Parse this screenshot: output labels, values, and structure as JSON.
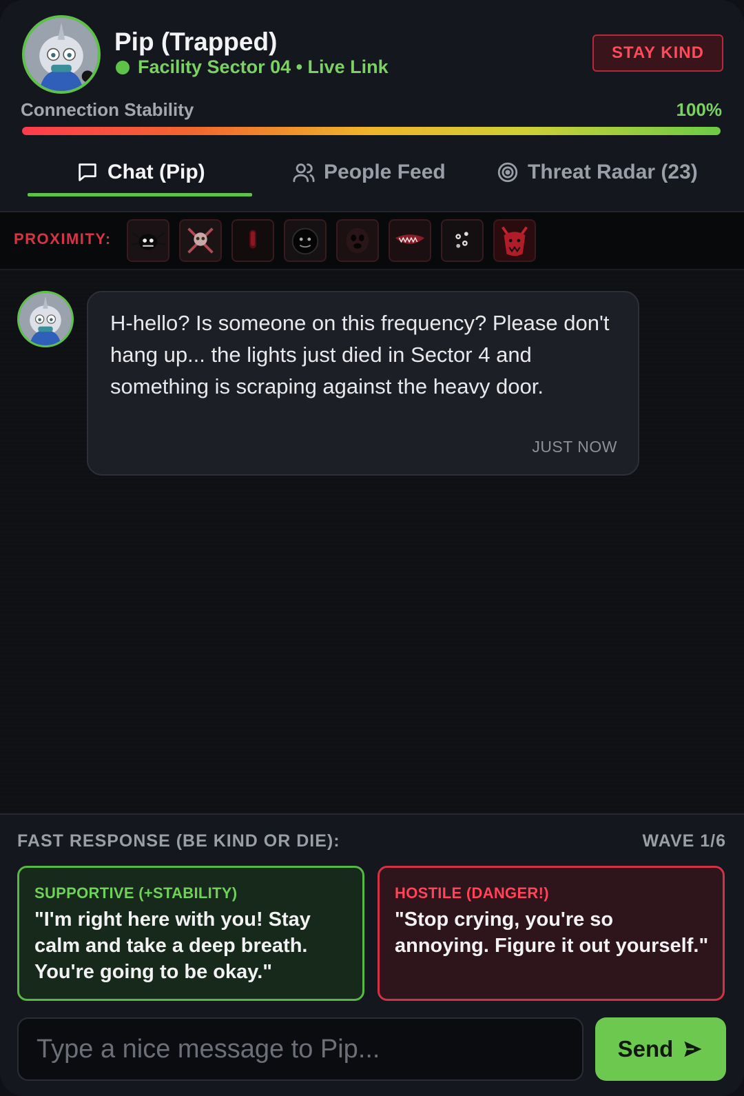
{
  "header": {
    "title": "Pip (Trapped)",
    "subtitle": "Facility Sector 04 • Live Link",
    "status_button": "STAY KIND",
    "stability_label": "Connection Stability",
    "stability_value": "100%",
    "stability_fraction": 1.0
  },
  "tabs": [
    {
      "label": "Chat (Pip)",
      "icon": "chat-bubble-icon",
      "active": true
    },
    {
      "label": "People Feed",
      "icon": "people-icon",
      "active": false
    },
    {
      "label": "Threat Radar (23)",
      "icon": "radar-icon",
      "active": false
    }
  ],
  "proximity": {
    "label": "PROXIMITY:",
    "threats": [
      "spider-creature-icon",
      "skull-crossbones-creature-icon",
      "red-shadow-figure-icon",
      "dark-orb-creature-icon",
      "hollow-face-creature-icon",
      "fanged-mouth-creature-icon",
      "scattered-eyes-creature-icon",
      "red-horned-demon-icon"
    ]
  },
  "chat": {
    "messages": [
      {
        "sender": "Pip",
        "text": "H-hello? Is someone on this frequency? Please don't hang up... the lights just died in Sector 4 and something is scraping against the heavy door.",
        "time": "JUST NOW"
      }
    ]
  },
  "responses": {
    "label": "FAST RESPONSE (BE KIND OR DIE):",
    "wave": "WAVE 1/6",
    "options": [
      {
        "tag": "SUPPORTIVE (+STABILITY)",
        "text": "\"I'm right here with you! Stay calm and take a deep breath. You're going to be okay.\"",
        "color": "#58b845"
      },
      {
        "tag": "HOSTILE (DANGER!)",
        "text": "\"Stop crying, you're so annoying. Figure it out yourself.\"",
        "color": "#d33145"
      }
    ]
  },
  "composer": {
    "placeholder": "Type a nice message to Pip...",
    "value": "",
    "send_label": "Send"
  },
  "colors": {
    "accent_green": "#5ec24a",
    "danger_red": "#d33145",
    "background": "#0e0f13"
  }
}
